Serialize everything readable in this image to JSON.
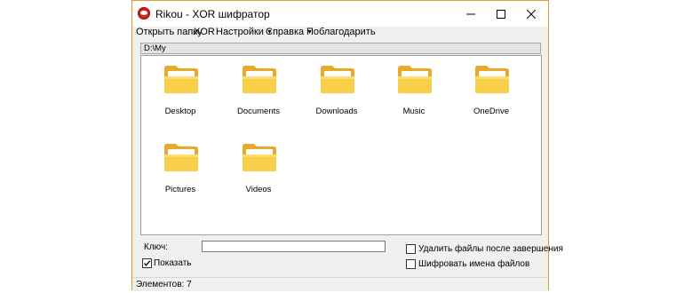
{
  "window": {
    "title": "Rikou - XOR шифратор"
  },
  "menu": {
    "items": [
      {
        "label": "Открыть папку",
        "has_arrow": false
      },
      {
        "label": "XOR",
        "has_arrow": false
      },
      {
        "label": "Настройки",
        "has_arrow": true
      },
      {
        "label": "Справка",
        "has_arrow": true
      },
      {
        "label": "Поблагодарить",
        "has_arrow": false
      }
    ]
  },
  "path": "D:\\My",
  "files": [
    {
      "name": "Desktop",
      "icon": "folder-icon"
    },
    {
      "name": "Documents",
      "icon": "folder-icon"
    },
    {
      "name": "Downloads",
      "icon": "folder-icon"
    },
    {
      "name": "Music",
      "icon": "folder-icon"
    },
    {
      "name": "OneDrive",
      "icon": "folder-icon"
    },
    {
      "name": "Pictures",
      "icon": "folder-icon"
    },
    {
      "name": "Videos",
      "icon": "folder-icon"
    }
  ],
  "key": {
    "label": "Ключ:",
    "value": ""
  },
  "show_key": {
    "label": "Показать",
    "checked": true
  },
  "delete_after": {
    "label": "Удалить файлы после завершения",
    "checked": false
  },
  "encrypt_names": {
    "label": "Шифровать имена файлов",
    "checked": false
  },
  "status": {
    "text": "Элементов: 7"
  },
  "colors": {
    "window_border": "#e39a33",
    "folder": "#f5c43a",
    "app_icon": "#d9281f"
  }
}
